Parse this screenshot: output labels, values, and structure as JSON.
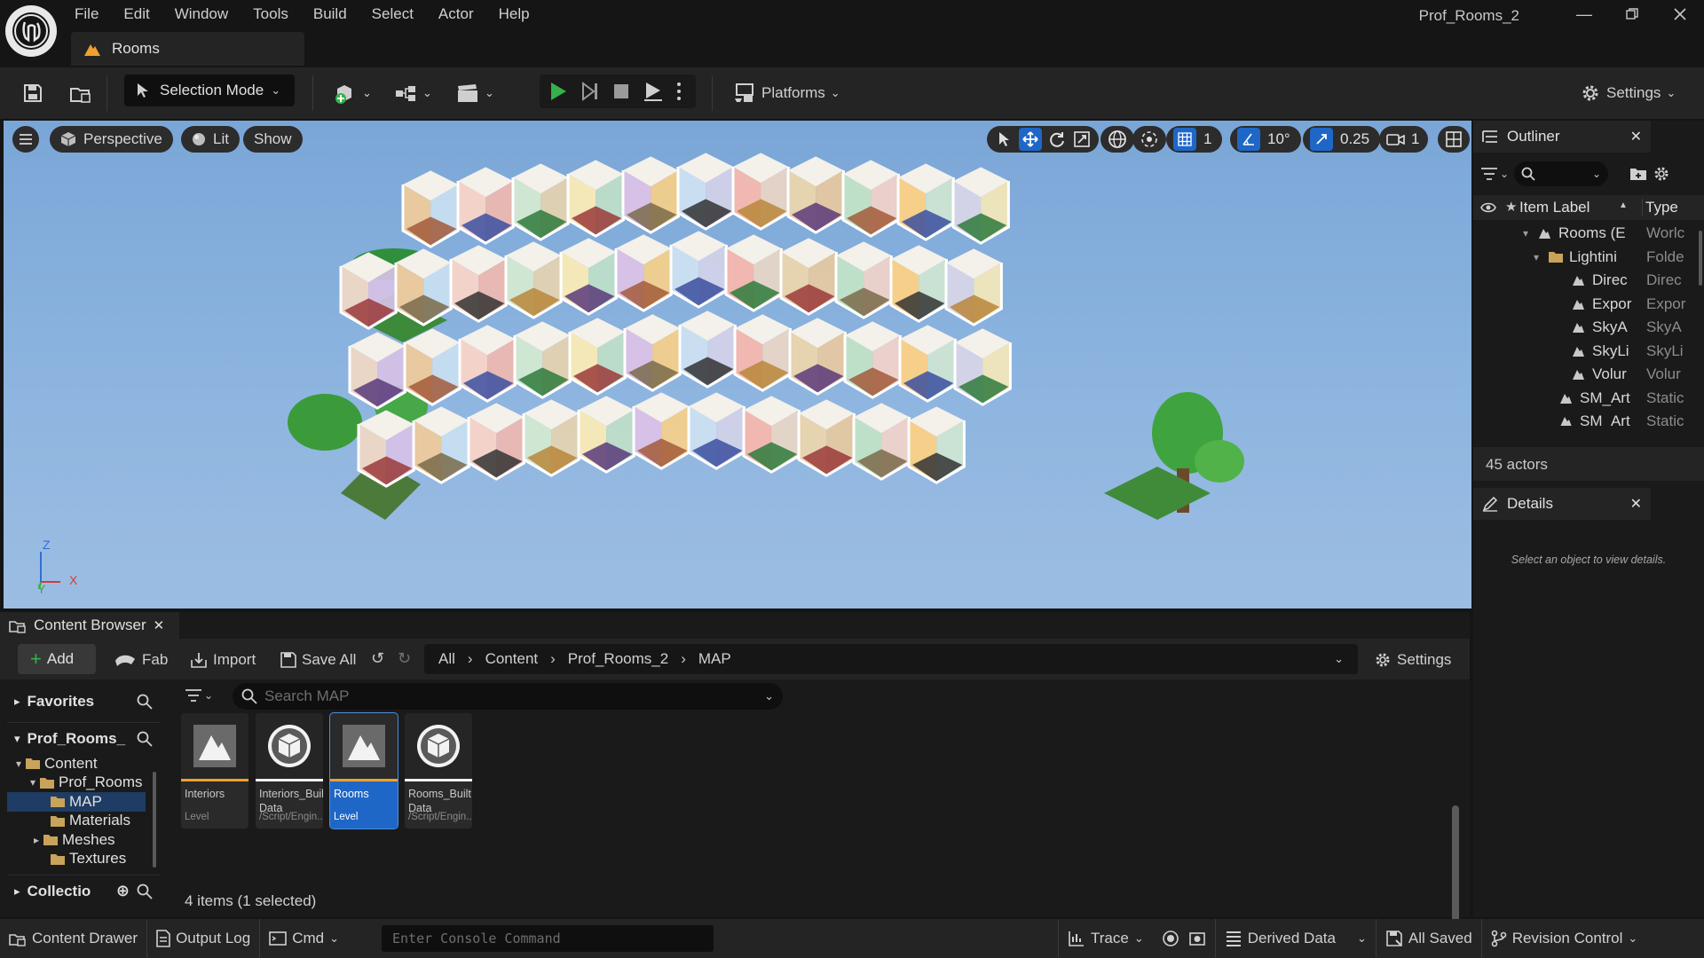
{
  "app": {
    "window_title": "Prof_Rooms_2",
    "level_tab": "Rooms",
    "menu": [
      "File",
      "Edit",
      "Window",
      "Tools",
      "Build",
      "Select",
      "Actor",
      "Help"
    ],
    "accent": "#1f67c7",
    "play_green": "#35b14b"
  },
  "toolbar": {
    "selection_mode": "Selection Mode",
    "platforms": "Platforms",
    "settings": "Settings"
  },
  "viewport": {
    "perspective": "Perspective",
    "lit": "Lit",
    "show": "Show",
    "grid_value": "1",
    "rotation_value": "10°",
    "scale_value": "0.25",
    "camera_speed": "1",
    "axis_labels": {
      "z": "Z",
      "x": "X",
      "y": "Y"
    }
  },
  "outliner": {
    "title": "Outliner",
    "col_label": "Item Label",
    "col_type": "Type",
    "rows": [
      {
        "label": "Rooms (E",
        "type": "Worlc"
      },
      {
        "label": "Lightini",
        "type": "Folde"
      },
      {
        "label": "Direc",
        "type": "Direc"
      },
      {
        "label": "Expor",
        "type": "Expor"
      },
      {
        "label": "SkyA",
        "type": "SkyA"
      },
      {
        "label": "SkyLi",
        "type": "SkyLi"
      },
      {
        "label": "Volur",
        "type": "Volur"
      },
      {
        "label": "SM_Art",
        "type": "Static"
      },
      {
        "label": "SM_Art",
        "type": "Static"
      }
    ],
    "count": "45 actors"
  },
  "details": {
    "title": "Details",
    "empty_text": "Select an object to view details."
  },
  "content_browser": {
    "title": "Content Browser",
    "add": "Add",
    "fab": "Fab",
    "import": "Import",
    "save_all": "Save All",
    "settings": "Settings",
    "breadcrumbs": [
      "All",
      "Content",
      "Prof_Rooms_2",
      "MAP"
    ],
    "search_placeholder": "Search MAP",
    "favorites": "Favorites",
    "project_root": "Prof_Rooms_",
    "collections": "Collectio",
    "tree": [
      "Content",
      "Prof_Rooms",
      "MAP",
      "Materials",
      "Meshes",
      "Textures"
    ],
    "assets": [
      {
        "name": "Interiors",
        "kind": "Level",
        "icon": "level-icon",
        "selected": false
      },
      {
        "name": "Interiors_Built Data",
        "kind": "/Script/Engin...",
        "icon": "data-icon",
        "selected": false
      },
      {
        "name": "Rooms",
        "kind": "Level",
        "icon": "level-icon",
        "selected": true
      },
      {
        "name": "Rooms_Built Data",
        "kind": "/Script/Engin...",
        "icon": "data-icon",
        "selected": false
      }
    ],
    "status": "4 items (1 selected)"
  },
  "statusbar": {
    "content_drawer": "Content Drawer",
    "output_log": "Output Log",
    "cmd": "Cmd",
    "console_placeholder": "Enter Console Command",
    "trace": "Trace",
    "derived_data": "Derived Data",
    "all_saved": "All Saved",
    "revision_control": "Revision Control"
  }
}
